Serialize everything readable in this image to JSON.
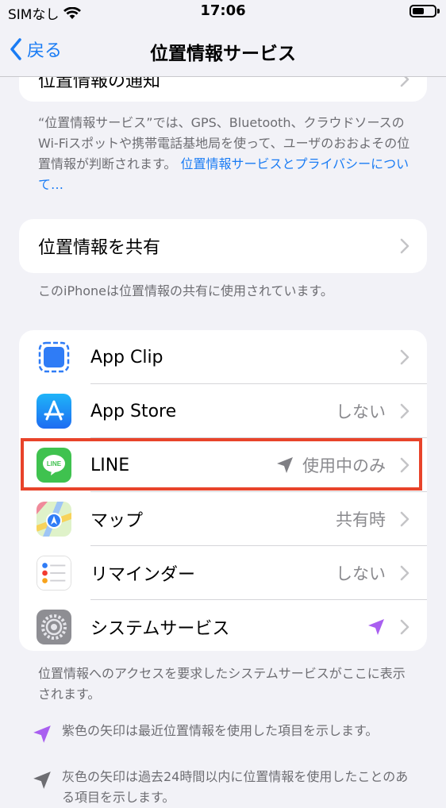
{
  "status": {
    "carrier": "SIMなし",
    "time": "17:06",
    "battery_level": 0.45
  },
  "nav": {
    "back_label": "戻る",
    "title": "位置情報サービス"
  },
  "top_card": {
    "label": "位置情報の通知"
  },
  "intro": {
    "text": "“位置情報サービス”では、GPS、Bluetooth、クラウドソースのWi-Fiスポットや携帯電話基地局を使って、ユーザのおおよその位置情報が判断されます。",
    "link": "位置情報サービスとプライバシーについて…"
  },
  "share": {
    "label": "位置情報を共有",
    "footer": "このiPhoneは位置情報の共有に使用されています。"
  },
  "apps": [
    {
      "name": "App Clip",
      "value": "",
      "icon": "app-clip-icon"
    },
    {
      "name": "App Store",
      "value": "しない",
      "icon": "app-store-icon"
    },
    {
      "name": "LINE",
      "value": "使用中のみ",
      "icon": "line-icon",
      "arrow": "gray",
      "line_icon_text": "LINE"
    },
    {
      "name": "マップ",
      "value": "共有時",
      "icon": "maps-icon"
    },
    {
      "name": "リマインダー",
      "value": "しない",
      "icon": "reminders-icon"
    },
    {
      "name": "システムサービス",
      "value": "",
      "icon": "settings-gear-icon",
      "arrow": "purple"
    }
  ],
  "apps_footer": "位置情報へのアクセスを要求したシステムサービスがここに表示されます。",
  "legend": [
    {
      "color": "#a95ff0",
      "text": "紫色の矢印は最近位置情報を使用した項目を示します。"
    },
    {
      "color": "#6d6d72",
      "text": "灰色の矢印は過去24時間以内に位置情報を使用したことのある項目を示します。"
    }
  ],
  "colors": {
    "accent": "#1a7cf4",
    "highlight": "#e8432a",
    "purple_arrow": "#a95ff0",
    "gray_arrow": "#7f7f84"
  }
}
